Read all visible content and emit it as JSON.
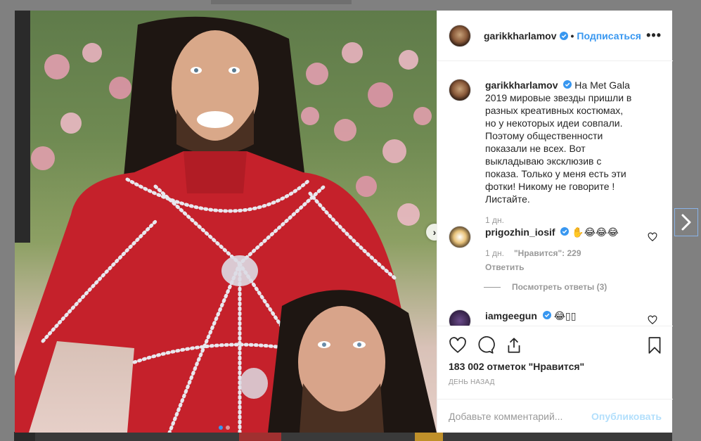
{
  "post": {
    "author": "garikkharlamov",
    "separator": "•",
    "follow_label": "Подписаться",
    "more_label": "•••",
    "caption": "На Met Gala 2019 мировые звезды пришли в разных креативных костюмах, но у некоторых идеи совпали. Поэтому общественности показали не всех. Вот выкладываю эксклюзив с показа. Только у меня есть эти фотки! Никому не говорите ! Листайте.",
    "caption_time": "1 дн.",
    "likes_text": "183 002 отметок \"Нравится\"",
    "post_time": "ДЕНЬ НАЗАД"
  },
  "comments": [
    {
      "user": "prigozhin_iosif",
      "text": "✋😂😂😂",
      "time": "1 дн.",
      "likes": "\"Нравится\": 229",
      "reply_label": "Ответить"
    },
    {
      "user": "iamgeegun",
      "text": "😂▯▯"
    }
  ],
  "view_replies_label": "Посмотреть ответы (3)",
  "add_comment": {
    "placeholder": "Добавьте комментарий...",
    "publish_label": "Опубликовать"
  },
  "colors": {
    "accent": "#3897f0",
    "verified": "#3897f0",
    "muted": "#999999",
    "publish_disabled": "#b2dffc"
  },
  "icons": {
    "like": "heart-icon",
    "comment": "comment-icon",
    "share": "share-icon",
    "save": "bookmark-icon",
    "next": "chevron-right-icon",
    "verified": "verified-badge-icon"
  }
}
